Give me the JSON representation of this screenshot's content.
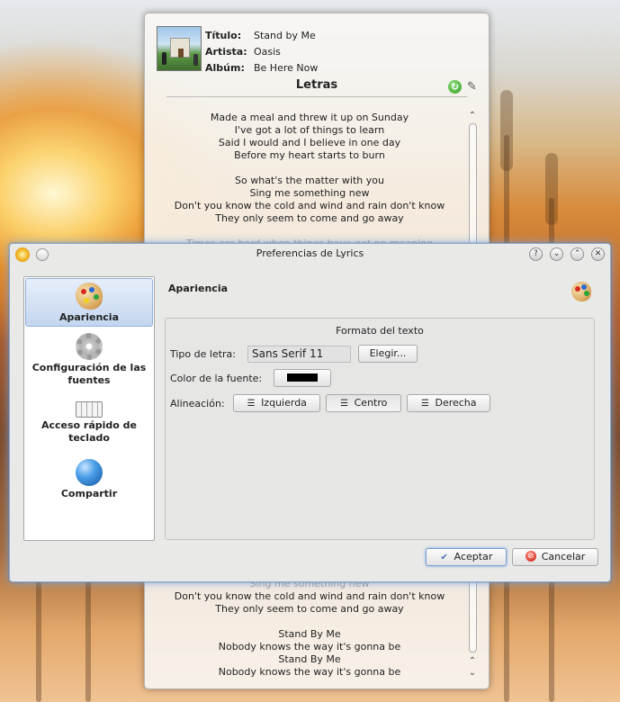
{
  "lyrics_widget": {
    "title_key": "Título:",
    "title_value": "Stand by Me",
    "artist_key": "Artista:",
    "artist_value": "Oasis",
    "album_key": "Albúm:",
    "album_value": "Be Here Now",
    "section_title": "Letras",
    "lyrics_top": [
      "Made a meal and threw it up on Sunday",
      "I've got a lot of things to learn",
      "Said I would and I believe in one day",
      "Before my heart starts to burn",
      "",
      "So what's the matter with you",
      "Sing me something new",
      "Don't you know the cold and wind and rain don't know",
      "They only seem to come and go away",
      "",
      "Times are hard when things have got no meaning"
    ],
    "lyrics_bottom": [
      "Sing me something new",
      "Don't you know the cold and wind and rain don't know",
      "They only seem to come and go away",
      "",
      "Stand By Me",
      "Nobody knows the way it's gonna be",
      "Stand By Me",
      "Nobody knows the way it's gonna be"
    ]
  },
  "dialog": {
    "title": "Preferencias de Lyrics",
    "sidebar": [
      {
        "label": "Apariencia",
        "icon": "palette-icon"
      },
      {
        "label": "Configuración de las fuentes",
        "icon": "gear-icon"
      },
      {
        "label": "Acceso rápido de teclado",
        "icon": "keyboard-icon"
      },
      {
        "label": "Compartir",
        "icon": "globe-icon"
      }
    ],
    "page_title": "Apariencia",
    "group_title": "Formato del texto",
    "font_label": "Tipo de letra:",
    "font_value": "Sans Serif 11",
    "choose_button": "Elegir...",
    "color_label": "Color de la fuente:",
    "font_color": "#000000",
    "align_label": "Alineación:",
    "align_left": "Izquierda",
    "align_center": "Centro",
    "align_right": "Derecha",
    "ok_button": "Aceptar",
    "cancel_button": "Cancelar"
  }
}
